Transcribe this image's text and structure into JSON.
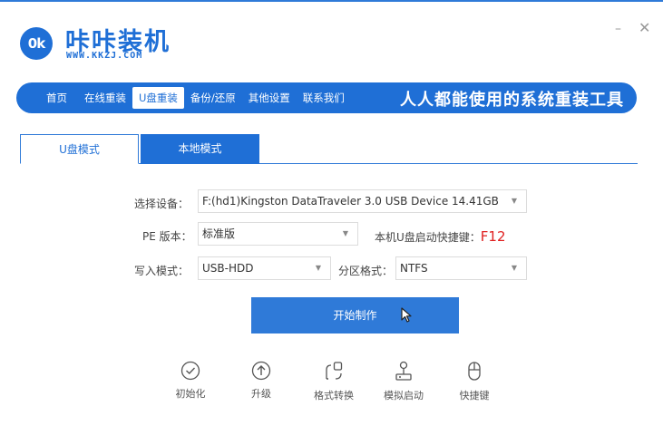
{
  "app": {
    "logo_text": "0k",
    "name": "咔咔装机",
    "url": "WWW.KKZJ.COM",
    "minimize": "–",
    "close": "✕"
  },
  "nav": {
    "items": [
      {
        "label": "首页"
      },
      {
        "label": "在线重装"
      },
      {
        "label": "U盘重装",
        "active": true
      },
      {
        "label": "备份/还原"
      },
      {
        "label": "其他设置"
      },
      {
        "label": "联系我们"
      }
    ],
    "slogan": "人人都能使用的系统重装工具"
  },
  "tabs": [
    {
      "label": "U盘模式",
      "active": true
    },
    {
      "label": "本地模式"
    }
  ],
  "form": {
    "device_label": "选择设备：",
    "device_value": "F:(hd1)Kingston DataTraveler 3.0 USB Device 14.41GB",
    "pe_label": "PE 版本：",
    "pe_value": "标准版",
    "hotkey_label": "本机U盘启动快捷键：",
    "hotkey_value": "F12",
    "write_label": "写入模式：",
    "write_value": "USB-HDD",
    "partition_label": "分区格式：",
    "partition_value": "NTFS",
    "dropdown_caret": "▼"
  },
  "start_button": "开始制作",
  "tools": [
    {
      "label": "初始化",
      "icon": "check-circle-icon"
    },
    {
      "label": "升级",
      "icon": "arrow-up-circle-icon"
    },
    {
      "label": "格式转换",
      "icon": "convert-icon"
    },
    {
      "label": "模拟启动",
      "icon": "joystick-icon"
    },
    {
      "label": "快捷键",
      "icon": "mouse-icon"
    }
  ],
  "colors": {
    "brand": "#1f6fd6",
    "button": "#2f7ad8",
    "hotkey": "#e02020"
  }
}
